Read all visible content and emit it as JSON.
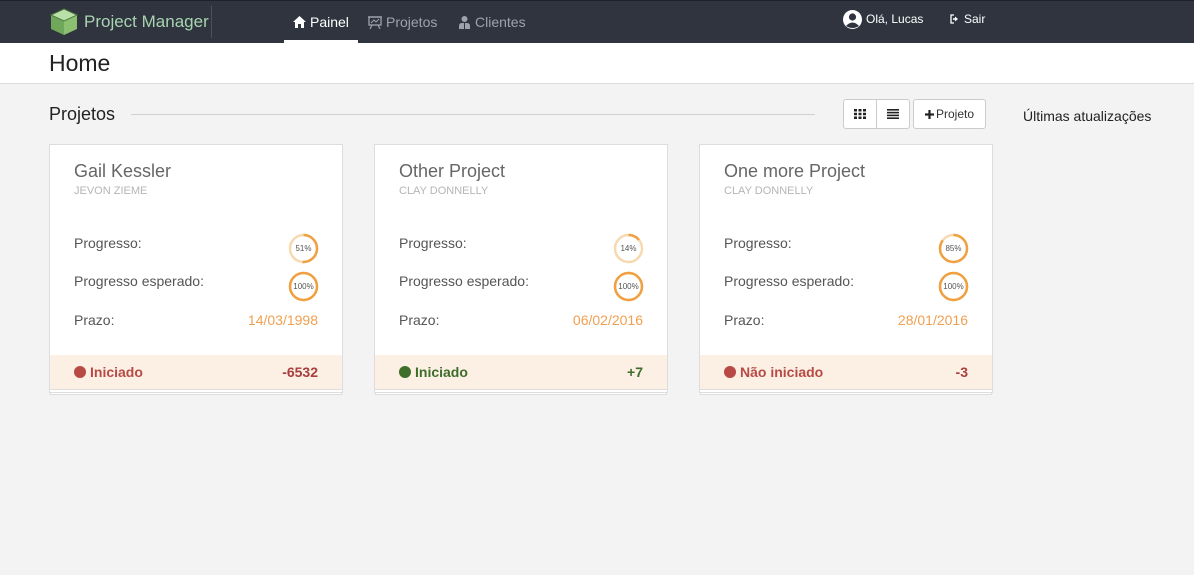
{
  "navbar": {
    "brand": "Project Manager",
    "items": [
      {
        "label": "Painel",
        "icon": "home-icon"
      },
      {
        "label": "Projetos",
        "icon": "presentation-board-icon"
      },
      {
        "label": "Clientes",
        "icon": "users-icon"
      }
    ],
    "user_greeting": "Olá, Lucas",
    "logout_label": "Sair"
  },
  "page": {
    "title": "Home"
  },
  "projects_section": {
    "title": "Projetos",
    "grid_view_icon": "grid-view-icon",
    "list_view_icon": "list-view-icon",
    "add_button_label": "Projeto",
    "updates_title": "Últimas atualizações"
  },
  "labels": {
    "progress": "Progresso:",
    "expected_progress": "Progresso esperado:",
    "deadline": "Prazo:"
  },
  "projects": [
    {
      "name": "Gail Kessler",
      "client": "JEVON ZIEME",
      "progress_pct": 51,
      "progress_text": "51%",
      "expected_pct": 100,
      "expected_text": "100%",
      "deadline": "14/03/1998",
      "status": "Iniciado",
      "status_color": "#b84a46",
      "delta": "-6532",
      "delta_color": "#a83e3e"
    },
    {
      "name": "Other Project",
      "client": "CLAY DONNELLY",
      "progress_pct": 14,
      "progress_text": "14%",
      "expected_pct": 100,
      "expected_text": "100%",
      "deadline": "06/02/2016",
      "status": "Iniciado",
      "status_color": "#3d6e2a",
      "delta": "+7",
      "delta_color": "#3d6e2a"
    },
    {
      "name": "One more Project",
      "client": "CLAY DONNELLY",
      "progress_pct": 85,
      "progress_text": "85%",
      "expected_pct": 100,
      "expected_text": "100%",
      "deadline": "28/01/2016",
      "status": "Não iniciado",
      "status_color": "#b84a46",
      "delta": "-3",
      "delta_color": "#a83e3e"
    }
  ],
  "colors": {
    "navbar_bg": "#2f343f",
    "brand_text": "#a8d4b0",
    "ring_fill": "#f0a040",
    "ring_track": "#f7d9b0",
    "deadline_text": "#f0a050",
    "footer_bg": "#fcefe3"
  }
}
